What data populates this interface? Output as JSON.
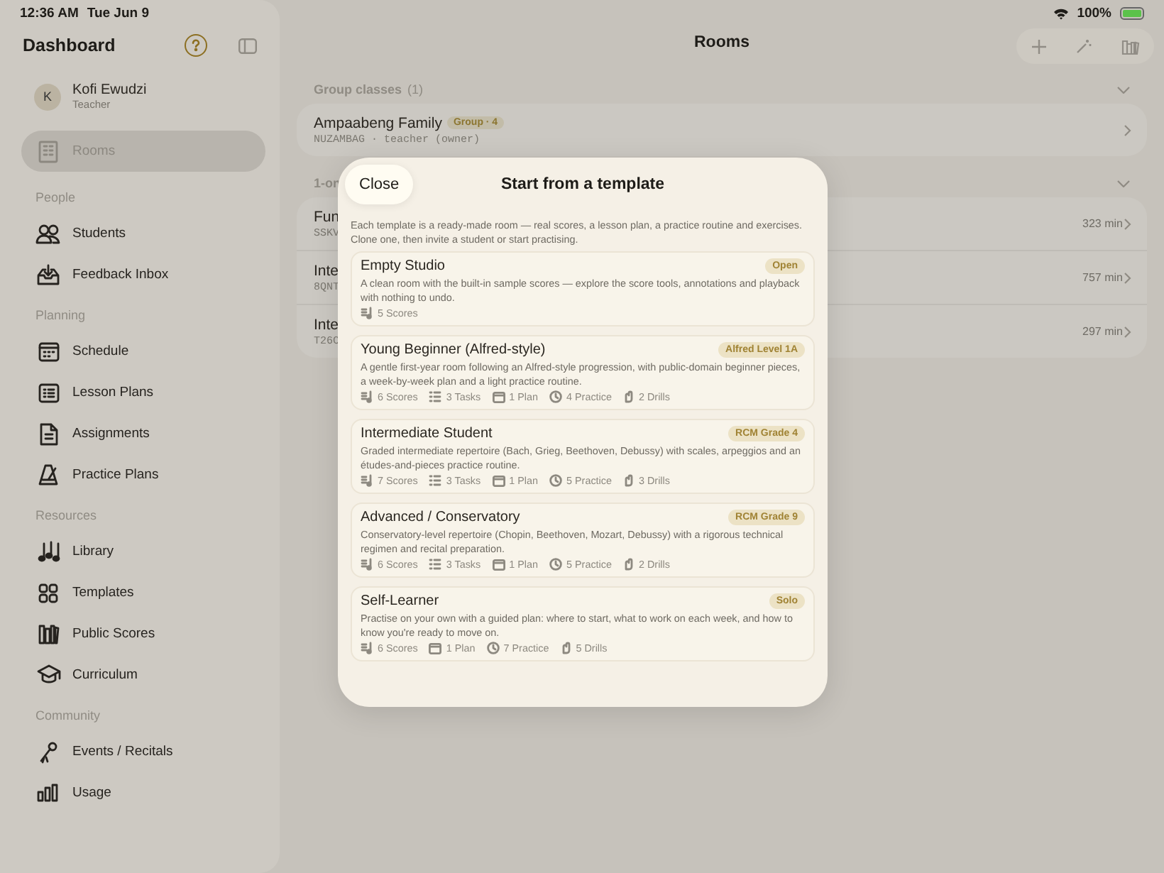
{
  "status_bar": {
    "time": "12:36 AM",
    "date": "Tue Jun 9",
    "battery": "100%"
  },
  "sidebar": {
    "title": "Dashboard",
    "user": {
      "initial": "K",
      "name": "Kofi Ewudzi",
      "role": "Teacher"
    },
    "items": [
      {
        "label": "Rooms",
        "selected": true
      }
    ],
    "sections": [
      {
        "title": "People",
        "items": [
          {
            "label": "Students",
            "selected": false
          },
          {
            "label": "Feedback Inbox",
            "selected": false
          }
        ]
      },
      {
        "title": "Planning",
        "items": [
          {
            "label": "Schedule",
            "selected": false
          },
          {
            "label": "Lesson Plans",
            "selected": false
          },
          {
            "label": "Assignments",
            "selected": false
          },
          {
            "label": "Practice Plans",
            "selected": false
          }
        ]
      },
      {
        "title": "Resources",
        "items": [
          {
            "label": "Library",
            "selected": false
          },
          {
            "label": "Templates",
            "selected": false
          },
          {
            "label": "Public Scores",
            "selected": false
          },
          {
            "label": "Curriculum",
            "selected": false
          }
        ]
      },
      {
        "title": "Community",
        "items": [
          {
            "label": "Events / Recitals",
            "selected": false
          },
          {
            "label": "Usage",
            "selected": false
          }
        ]
      }
    ]
  },
  "main": {
    "title": "Rooms",
    "group_section": {
      "title": "Group classes",
      "count": "(1)",
      "rooms": [
        {
          "name": "Ampaabeng Family",
          "badge": "Group · 4",
          "code": "NUZAMBAG · teacher (owner)"
        }
      ]
    },
    "one_on_one_section": {
      "title": "1-on",
      "rooms": [
        {
          "name": "Fun",
          "code": "SSKV",
          "minutes": "323 min"
        },
        {
          "name": "Inte",
          "code": "8QNT",
          "minutes": "757 min"
        },
        {
          "name": "Inte",
          "code": "T26C",
          "minutes": "297 min"
        }
      ]
    }
  },
  "modal": {
    "close": "Close",
    "title": "Start from a template",
    "intro": "Each template is a ready-made room — real scores, a lesson plan, a practice routine and exercises. Clone one, then invite a student or start practising.",
    "templates": [
      {
        "name": "Empty Studio",
        "badge": "Open",
        "description": "A clean room with the built-in sample scores — explore the score tools, annotations and playback with nothing to undo.",
        "stats": [
          {
            "kind": "scores",
            "text": "5 Scores"
          }
        ]
      },
      {
        "name": "Young Beginner (Alfred-style)",
        "badge": "Alfred Level 1A",
        "description": "A gentle first-year room following an Alfred-style progression, with public-domain beginner pieces, a week-by-week plan and a light practice routine.",
        "stats": [
          {
            "kind": "scores",
            "text": "6 Scores"
          },
          {
            "kind": "tasks",
            "text": "3 Tasks"
          },
          {
            "kind": "plan",
            "text": "1 Plan"
          },
          {
            "kind": "practice",
            "text": "4 Practice"
          },
          {
            "kind": "drills",
            "text": "2 Drills"
          }
        ]
      },
      {
        "name": "Intermediate Student",
        "badge": "RCM Grade 4",
        "description": "Graded intermediate repertoire (Bach, Grieg, Beethoven, Debussy) with scales, arpeggios and an études-and-pieces practice routine.",
        "stats": [
          {
            "kind": "scores",
            "text": "7 Scores"
          },
          {
            "kind": "tasks",
            "text": "3 Tasks"
          },
          {
            "kind": "plan",
            "text": "1 Plan"
          },
          {
            "kind": "practice",
            "text": "5 Practice"
          },
          {
            "kind": "drills",
            "text": "3 Drills"
          }
        ]
      },
      {
        "name": "Advanced / Conservatory",
        "badge": "RCM Grade 9",
        "description": "Conservatory-level repertoire (Chopin, Beethoven, Mozart, Debussy) with a rigorous technical regimen and recital preparation.",
        "stats": [
          {
            "kind": "scores",
            "text": "6 Scores"
          },
          {
            "kind": "tasks",
            "text": "3 Tasks"
          },
          {
            "kind": "plan",
            "text": "1 Plan"
          },
          {
            "kind": "practice",
            "text": "5 Practice"
          },
          {
            "kind": "drills",
            "text": "2 Drills"
          }
        ]
      },
      {
        "name": "Self-Learner",
        "badge": "Solo",
        "description": "Practise on your own with a guided plan: where to start, what to work on each week, and how to know you're ready to move on.",
        "stats": [
          {
            "kind": "scores",
            "text": "6 Scores"
          },
          {
            "kind": "plan",
            "text": "1 Plan"
          },
          {
            "kind": "practice",
            "text": "7 Practice"
          },
          {
            "kind": "drills",
            "text": "5 Drills"
          }
        ]
      }
    ]
  }
}
